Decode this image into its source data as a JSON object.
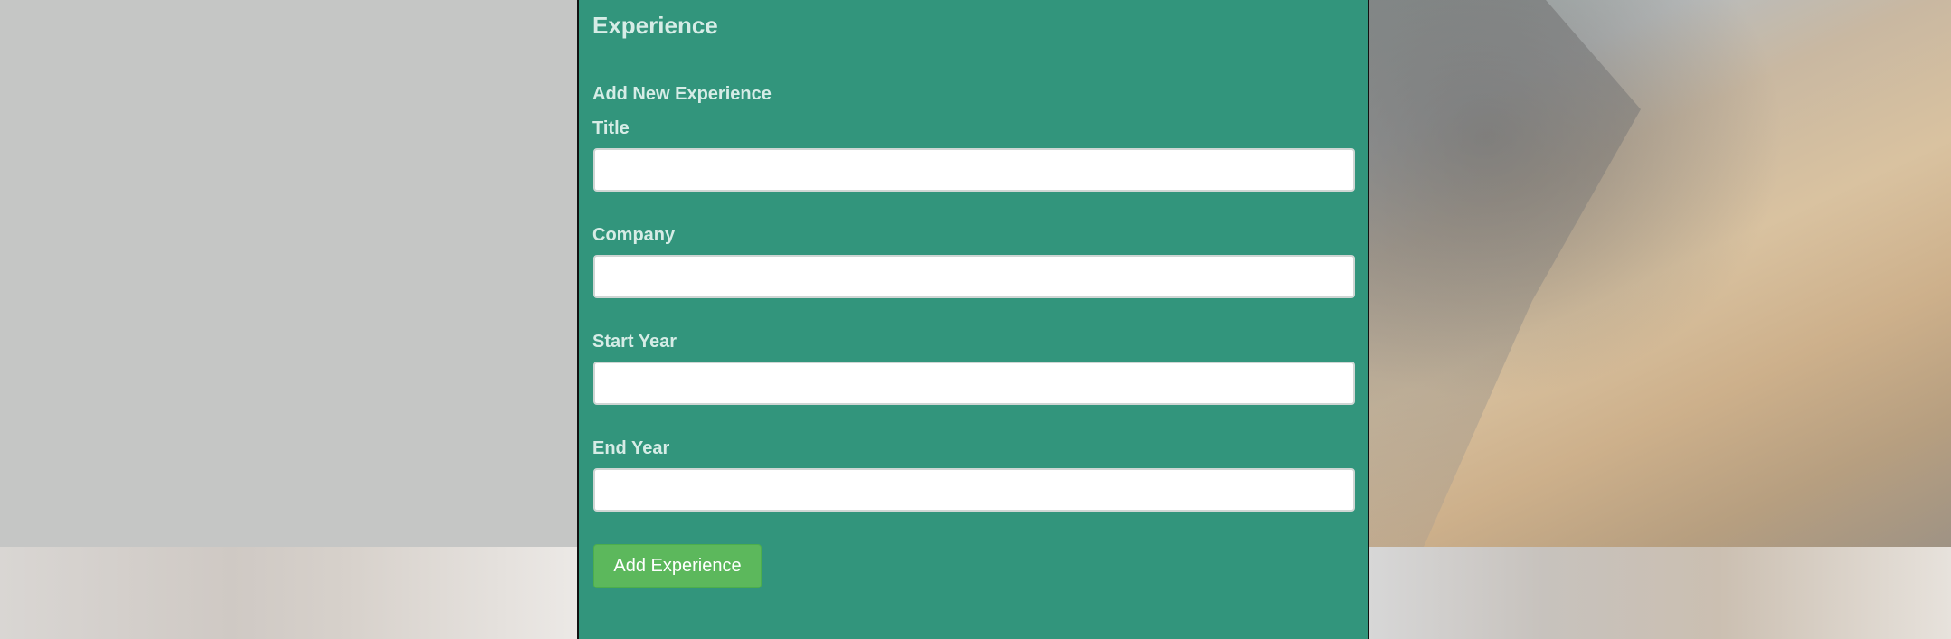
{
  "panel": {
    "heading": "Experience",
    "form_title": "Add New Experience"
  },
  "fields": [
    {
      "label": "Title",
      "value": ""
    },
    {
      "label": "Company",
      "value": ""
    },
    {
      "label": "Start Year",
      "value": ""
    },
    {
      "label": "End Year",
      "value": ""
    }
  ],
  "submit_label": "Add Experience",
  "colors": {
    "panel_bg": "#32957c",
    "label_text": "#d6ece6",
    "button_bg": "#5cb85c"
  }
}
